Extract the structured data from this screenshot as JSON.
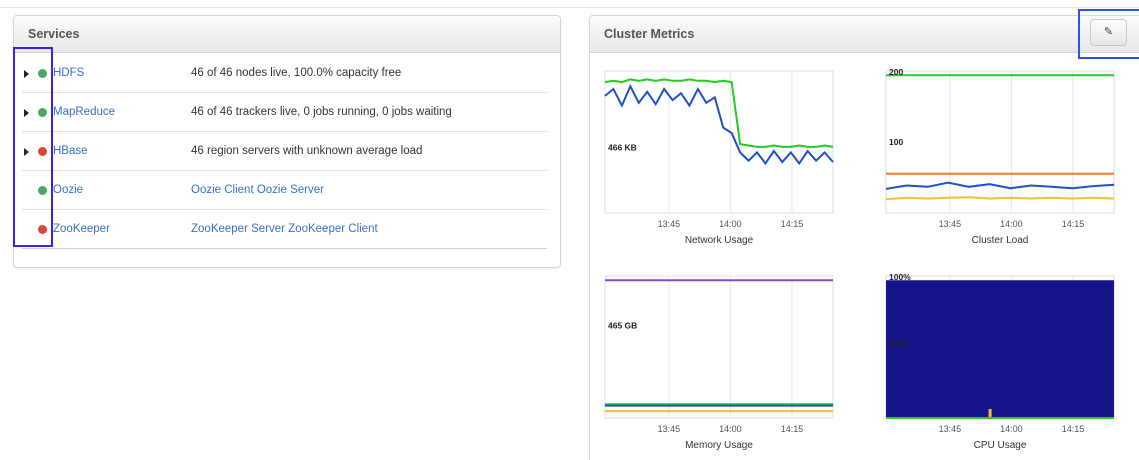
{
  "services": {
    "title": "Services",
    "rows": [
      {
        "name": "HDFS",
        "status": "46 of 46 nodes live, 100.0% capacity free",
        "health": "green",
        "expandable": true
      },
      {
        "name": "MapReduce",
        "status": "46 of 46 trackers live, 0 jobs running, 0 jobs waiting",
        "health": "green",
        "expandable": true
      },
      {
        "name": "HBase",
        "status": "46 region servers with unknown average load",
        "health": "red",
        "expandable": true
      },
      {
        "name": "Oozie",
        "links": [
          "Oozie Client",
          "Oozie Server"
        ],
        "health": "green",
        "expandable": false
      },
      {
        "name": "ZooKeeper",
        "links": [
          "ZooKeeper Server",
          "ZooKeeper Client"
        ],
        "health": "red",
        "expandable": false
      }
    ]
  },
  "metrics": {
    "title": "Cluster Metrics",
    "edit_icon": "pencil-icon",
    "edit_glyph": "✎"
  },
  "colors": {
    "green": "#22cc22",
    "blue": "#1f4fcc",
    "orange": "#f07a2a",
    "yellow": "#f2c12e",
    "purple": "#7b4fc9",
    "cpu_fill": "#16168a"
  },
  "chart_data": [
    {
      "type": "line",
      "title": "Network Usage",
      "x_ticks": [
        "13:45",
        "14:00",
        "14:15"
      ],
      "y_labels": [
        "466 KB"
      ],
      "series": [
        {
          "color": "green",
          "values": [
            0.95,
            0.96,
            0.95,
            0.97,
            0.96,
            0.97,
            0.96,
            0.97,
            0.96,
            0.96,
            0.97,
            0.96,
            0.96,
            0.95,
            0.96,
            0.95,
            0.5,
            0.49,
            0.48,
            0.48,
            0.49,
            0.48,
            0.48,
            0.49,
            0.48,
            0.48,
            0.49,
            0.48
          ]
        },
        {
          "color": "blue",
          "values": [
            0.85,
            0.9,
            0.78,
            0.92,
            0.8,
            0.88,
            0.79,
            0.9,
            0.82,
            0.87,
            0.78,
            0.9,
            0.8,
            0.84,
            0.62,
            0.58,
            0.44,
            0.38,
            0.44,
            0.36,
            0.45,
            0.37,
            0.44,
            0.36,
            0.45,
            0.38,
            0.44,
            0.37
          ]
        }
      ]
    },
    {
      "type": "line",
      "title": "Cluster Load",
      "x_ticks": [
        "13:45",
        "14:00",
        "14:15"
      ],
      "y_labels": [
        "200",
        "100"
      ],
      "ylim": [
        0,
        200
      ],
      "series": [
        {
          "color": "green",
          "values": [
            200,
            200,
            200,
            200,
            200,
            200,
            200,
            200,
            200,
            200,
            200,
            200
          ]
        },
        {
          "color": "orange",
          "values": [
            57,
            57,
            57,
            57,
            57,
            57,
            57,
            57,
            57,
            57,
            57,
            57
          ]
        },
        {
          "color": "blue",
          "values": [
            35,
            40,
            38,
            44,
            38,
            42,
            36,
            40,
            38,
            36,
            39,
            41
          ]
        },
        {
          "color": "yellow",
          "values": [
            20,
            22,
            21,
            22,
            23,
            21,
            22,
            21,
            22,
            21,
            22,
            21
          ]
        }
      ]
    },
    {
      "type": "line",
      "title": "Memory Usage",
      "x_ticks": [
        "13:45",
        "14:00",
        "14:15"
      ],
      "y_labels": [
        "465 GB"
      ],
      "series": [
        {
          "color": "purple",
          "values": [
            1,
            1,
            1,
            1,
            1,
            1,
            1,
            1
          ]
        },
        {
          "color": "green",
          "values": [
            0.1,
            0.1,
            0.1,
            0.1,
            0.1,
            0.1,
            0.1,
            0.1
          ]
        },
        {
          "color": "blue",
          "values": [
            0.09,
            0.09,
            0.09,
            0.09,
            0.09,
            0.09,
            0.09,
            0.09
          ]
        },
        {
          "color": "yellow",
          "values": [
            0.05,
            0.05,
            0.05,
            0.05,
            0.05,
            0.05,
            0.05,
            0.05
          ]
        }
      ]
    },
    {
      "type": "area",
      "title": "CPU Usage",
      "x_ticks": [
        "13:45",
        "14:00",
        "14:15"
      ],
      "y_labels": [
        "100%",
        "50%"
      ],
      "series": [
        {
          "color": "cpu_fill",
          "values": [
            1,
            1,
            1,
            1,
            1,
            1,
            1,
            1
          ]
        }
      ]
    }
  ]
}
